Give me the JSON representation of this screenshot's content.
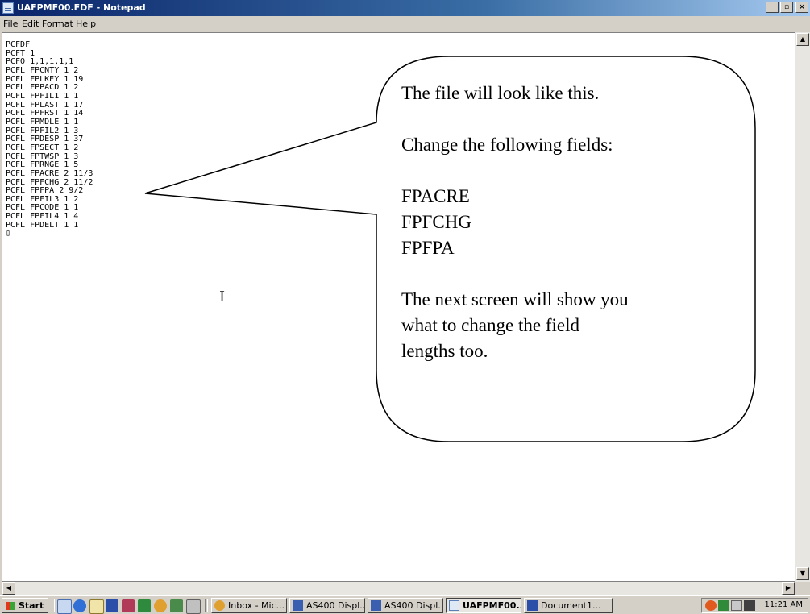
{
  "window": {
    "title": "UAFPMF00.FDF - Notepad",
    "controls": [
      "_",
      "̸",
      "x"
    ]
  },
  "menu": [
    "File",
    "Edit",
    "Format",
    "Help"
  ],
  "editor": {
    "lines": [
      "PCFDF",
      "PCFT 1",
      "PCFO 1,1,1,1,1",
      "PCFL FPCNTY 1 2",
      "PCFL FPLKEY 1 19",
      "PCFL FPPACD 1 2",
      "PCFL FPFIL1 1 1",
      "PCFL FPLAST 1 17",
      "PCFL FPFRST 1 14",
      "PCFL FPMDLE 1 1",
      "PCFL FPFIL2 1 3",
      "PCFL FPDESP 1 37",
      "PCFL FPSECT 1 2",
      "PCFL FPTWSP 1 3",
      "PCFL FPRNGE 1 5",
      "PCFL FPACRE 2 11/3",
      "PCFL FPFCHG 2 11/2",
      "PCFL FPFPA 2 9/2",
      "PCFL FPFIL3 1 2",
      "PCFL FPCODE 1 1",
      "PCFL FPFIL4 1 4",
      "PCFL FPDELT 1 1",
      "▯"
    ]
  },
  "callout": {
    "lines": [
      "The file will look like this.",
      "",
      "Change the following fields:",
      "",
      "FPACRE",
      "FPFCHG",
      "FPFPA",
      "",
      "The next screen will show you",
      "what to change the field",
      "lengths too."
    ]
  },
  "cursor_glyph": "I",
  "taskbar": {
    "start_label": "Start",
    "buttons": [
      "Inbox - Mic...",
      "AS400 Displ...",
      "AS400 Displ...",
      "UAFPMF00...",
      "Document1..."
    ],
    "active_index": 3,
    "clock": "11:21 AM"
  },
  "colors": {
    "titlebar_start": "#0a246a",
    "titlebar_end": "#a6caf0",
    "chrome": "#d4d0c8"
  }
}
